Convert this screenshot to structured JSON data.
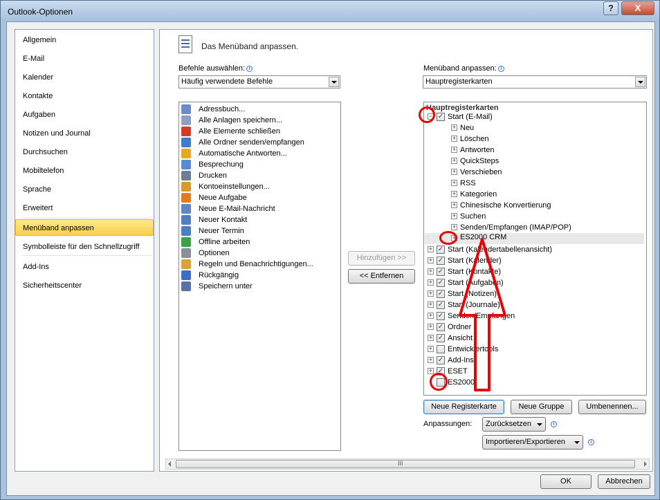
{
  "window": {
    "title": "Outlook-Optionen",
    "help_glyph": "?",
    "close_glyph": "X"
  },
  "nav": {
    "items": [
      {
        "label": "Allgemein"
      },
      {
        "label": "E-Mail"
      },
      {
        "label": "Kalender"
      },
      {
        "label": "Kontakte"
      },
      {
        "label": "Aufgaben"
      },
      {
        "label": "Notizen und Journal"
      },
      {
        "label": "Durchsuchen"
      },
      {
        "label": "Mobiltelefon"
      },
      {
        "label": "Sprache"
      },
      {
        "label": "Erweitert"
      },
      {
        "label": "Menüband anpassen",
        "selected": true
      },
      {
        "label": "Symbolleiste für den Schnellzugriff"
      },
      {
        "label": "Add-Ins"
      },
      {
        "label": "Sicherheitscenter"
      }
    ]
  },
  "main": {
    "header_title": "Das Menüband anpassen.",
    "commands_label": "Befehle auswählen:",
    "commands_combo_value": "Häufig verwendete Befehle",
    "ribbon_label": "Menüband anpassen:",
    "ribbon_combo_value": "Hauptregisterkarten",
    "commands": [
      {
        "label": "Adressbuch...",
        "icon": "address-book-icon",
        "color": "#6b8cc7"
      },
      {
        "label": "Alle Anlagen speichern...",
        "icon": "save-attachments-icon",
        "color": "#8da0c0"
      },
      {
        "label": "Alle Elemente schließen",
        "icon": "close-all-icon",
        "color": "#d23a2a"
      },
      {
        "label": "Alle Ordner senden/empfangen",
        "icon": "send-receive-icon",
        "color": "#3f7bd1"
      },
      {
        "label": "Automatische Antworten...",
        "icon": "auto-reply-icon",
        "color": "#e5a820"
      },
      {
        "label": "Besprechung",
        "icon": "meeting-icon",
        "color": "#5a8ad0"
      },
      {
        "label": "Drucken",
        "icon": "print-icon",
        "color": "#6e7e97"
      },
      {
        "label": "Kontoeinstellungen...",
        "icon": "account-settings-icon",
        "color": "#d89a2c"
      },
      {
        "label": "Neue Aufgabe",
        "icon": "new-task-icon",
        "color": "#e07b22"
      },
      {
        "label": "Neue E-Mail-Nachricht",
        "icon": "new-mail-icon",
        "color": "#5b87c4"
      },
      {
        "label": "Neuer Kontakt",
        "icon": "new-contact-icon",
        "color": "#4f7fbe"
      },
      {
        "label": "Neuer Termin",
        "icon": "new-appointment-icon",
        "color": "#4d7cc0"
      },
      {
        "label": "Offline arbeiten",
        "icon": "offline-icon",
        "color": "#3fa04a"
      },
      {
        "label": "Optionen",
        "icon": "options-icon",
        "color": "#8a8f9a"
      },
      {
        "label": "Regeln und Benachrichtigungen...",
        "icon": "rules-icon",
        "color": "#d9a33a"
      },
      {
        "label": "Rückgängig",
        "icon": "undo-icon",
        "color": "#3b6fc5"
      },
      {
        "label": "Speichern unter",
        "icon": "save-as-icon",
        "color": "#5872a8"
      }
    ],
    "add_button": "Hinzufügen >>",
    "remove_button": "<< Entfernen",
    "tree": {
      "header": "Hauptregisterkarten",
      "start_mail": {
        "label": "Start (E-Mail)",
        "expander": "−",
        "checked": true
      },
      "groups": [
        "Neu",
        "Löschen",
        "Antworten",
        "QuickSteps",
        "Verschieben",
        "RSS",
        "Kategorien",
        "Chinesische Konvertierung",
        "Suchen",
        "Senden/Empfangen (IMAP/POP)"
      ],
      "highlighted_group": "ES2000 CRM",
      "tabs": [
        {
          "label": "Start (Kalendertabellenansicht)",
          "checked": true,
          "expander": "+"
        },
        {
          "label": "Start (Kalender)",
          "checked": true,
          "expander": "+"
        },
        {
          "label": "Start (Kontakte)",
          "checked": true,
          "expander": "+"
        },
        {
          "label": "Start (Aufgaben)",
          "checked": true,
          "expander": "+"
        },
        {
          "label": "Start (Notizen)",
          "checked": true,
          "expander": "+"
        },
        {
          "label": "Start (Journale)",
          "checked": true,
          "expander": "+"
        },
        {
          "label": "Senden/Empfangen",
          "checked": true,
          "expander": "+"
        },
        {
          "label": "Ordner",
          "checked": true,
          "expander": "+"
        },
        {
          "label": "Ansicht",
          "checked": true,
          "expander": "+"
        },
        {
          "label": "Entwicklertools",
          "checked": false,
          "expander": "+"
        },
        {
          "label": "Add-Ins",
          "checked": true,
          "expander": "+"
        },
        {
          "label": "ESET",
          "checked": true,
          "expander": "+"
        },
        {
          "label": "ES2000",
          "checked": false,
          "expander": ""
        }
      ],
      "check_glyph": "✓",
      "plus_glyph": "+"
    },
    "new_tab_button": "Neue Registerkarte",
    "new_group_button": "Neue Gruppe",
    "rename_button": "Umbenennen...",
    "customizations_label": "Anpassungen:",
    "reset_button": "Zurücksetzen",
    "import_export_button": "Importieren/Exportieren",
    "scroll_grip": "III"
  },
  "footer": {
    "ok_button": "OK",
    "cancel_button": "Abbrechen"
  },
  "annotation_color": "#e60000"
}
